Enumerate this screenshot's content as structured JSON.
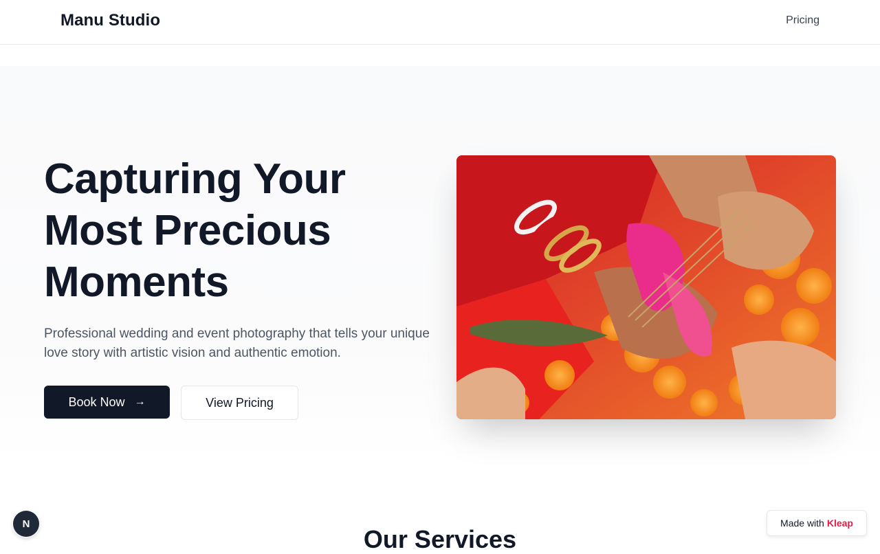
{
  "nav": {
    "brand": "Manu Studio",
    "links": [
      {
        "label": "Pricing"
      }
    ]
  },
  "hero": {
    "headline": "Capturing Your Most Precious Moments",
    "subtitle": "Professional wedding and event photography that tells your unique love story with artistic vision and authentic emotion.",
    "primary_button": {
      "label": "Book Now",
      "icon": "arrow-right-icon"
    },
    "secondary_button": {
      "label": "View Pricing"
    },
    "image": {
      "subject": "wedding-ceremony-hands-photo"
    }
  },
  "services": {
    "title": "Our Services"
  },
  "badge": {
    "letter": "N"
  },
  "made_with": {
    "prefix": "Made with",
    "brand": "Kleap"
  },
  "colors": {
    "primary": "#111827",
    "text_muted": "#4b5563",
    "accent": "#e11d48",
    "hero_bg": "#f9fafb",
    "border": "#e5e7eb"
  }
}
